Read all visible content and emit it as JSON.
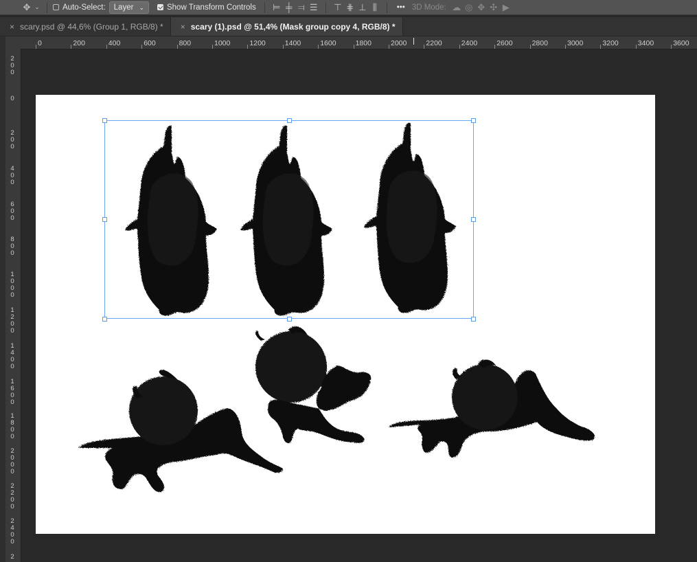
{
  "options_bar": {
    "move_tool_icon": "move-tool-icon",
    "auto_select_label": "Auto-Select:",
    "auto_select_checked": false,
    "auto_select_target": "Layer",
    "show_transform_label": "Show Transform Controls",
    "show_transform_checked": true,
    "more_label": "•••",
    "mode_3d_label": "3D Mode:"
  },
  "tabs": [
    {
      "label": "scary.psd @ 44,6% (Group 1, RGB/8) *",
      "active": false
    },
    {
      "label": "scary (1).psd @ 51,4% (Mask group copy 4, RGB/8) *",
      "active": true
    }
  ],
  "ruler_h": [
    "0",
    "200",
    "400",
    "600",
    "800",
    "1000",
    "1200",
    "1400",
    "1600",
    "1800",
    "2000",
    "2200",
    "2400",
    "2600",
    "2800",
    "3000",
    "3200",
    "3400",
    "3600"
  ],
  "ruler_v": [
    "200",
    "0",
    "200",
    "400",
    "600",
    "800",
    "1000",
    "1200",
    "1400",
    "1600",
    "1800",
    "2000",
    "2200",
    "2400",
    "2"
  ],
  "colors": {
    "selection": "#6aa7f2",
    "canvas": "#ffffff",
    "workspace": "#282828"
  }
}
